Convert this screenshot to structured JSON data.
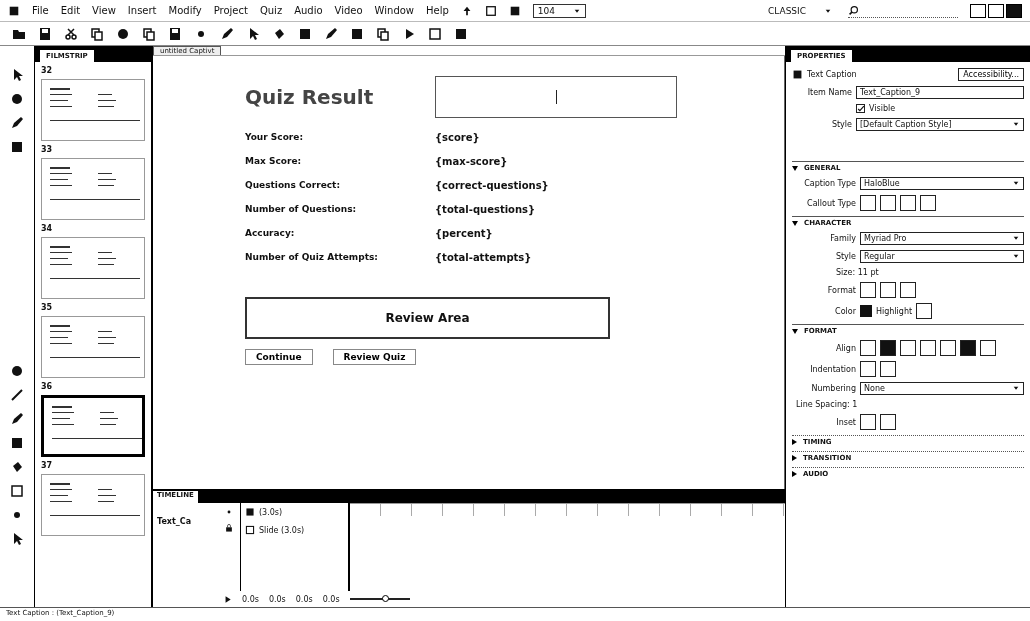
{
  "menu": [
    "File",
    "Edit",
    "View",
    "Insert",
    "Modify",
    "Project",
    "Quiz",
    "Audio",
    "Video",
    "Window",
    "Help"
  ],
  "zoom": {
    "value": "104"
  },
  "workspace": {
    "label": "CLASSIC"
  },
  "filmstrip": {
    "title": "FILMSTRIP",
    "slides": [
      {
        "number": "32",
        "selected": false
      },
      {
        "number": "33",
        "selected": false
      },
      {
        "number": "34",
        "selected": false
      },
      {
        "number": "35",
        "selected": false
      },
      {
        "number": "36",
        "selected": true
      },
      {
        "number": "37",
        "selected": false
      }
    ]
  },
  "document_tab": {
    "title": "untitled Captivt"
  },
  "slide": {
    "title": "Quiz Result",
    "rows": [
      {
        "label": "Your Score:",
        "value": "{score}"
      },
      {
        "label": "Max Score:",
        "value": "{max-score}"
      },
      {
        "label": "Questions Correct:",
        "value": "{correct-questions}"
      },
      {
        "label": "Number of Questions:",
        "value": "{total-questions}"
      },
      {
        "label": "Accuracy:",
        "value": "{percent}"
      },
      {
        "label": "Number of Quiz Attempts:",
        "value": "{total-attempts}"
      }
    ],
    "review_area": "Review Area",
    "buttons": [
      "Continue",
      "Review Quiz"
    ]
  },
  "timeline": {
    "title": "TIMELINE",
    "layer": "Text_Ca",
    "items": [
      "(3.0s)",
      "Slide (3.0s)"
    ],
    "times": [
      "0.0s",
      "0.0s",
      "0.0s",
      "0.0s"
    ],
    "zoom_slider": {
      "level": 0.6
    }
  },
  "properties": {
    "title": "PROPERTIES",
    "object": "Text Caption",
    "accessibility": "Accessibility...",
    "item_name_label": "Item Name",
    "item_name": "Text_Caption_9",
    "visible": {
      "label": "Visible",
      "checked": true
    },
    "style_label": "Style",
    "style": "[Default Caption Style]",
    "sections": [
      {
        "title": "GENERAL",
        "expanded": true,
        "kind": "general"
      },
      {
        "title": "CHARACTER",
        "expanded": true,
        "kind": "character"
      },
      {
        "title": "FORMAT",
        "expanded": true,
        "kind": "format"
      },
      {
        "title": "TIMING",
        "expanded": false,
        "kind": "none"
      },
      {
        "title": "TRANSITION",
        "expanded": false,
        "kind": "none"
      },
      {
        "title": "AUDIO",
        "expanded": false,
        "kind": "none"
      }
    ],
    "general": {
      "caption_type_label": "Caption Type",
      "caption_type": "HaloBlue",
      "callout_type_label": "Callout Type"
    },
    "character": {
      "family_label": "Family",
      "family": "Myriad Pro",
      "style_label": "Style",
      "style": "Regular",
      "size": "Size: 11 pt",
      "format_label": "Format",
      "color_label": "Color",
      "highlight_label": "Highlight"
    },
    "format": {
      "align_label": "Align",
      "align_options": [
        {
          "selected": false
        },
        {
          "selected": true
        },
        {
          "selected": false
        },
        {
          "selected": false
        },
        {
          "selected": false
        },
        {
          "selected": true
        },
        {
          "selected": false
        }
      ],
      "indentation_label": "Indentation",
      "numbering_label": "Numbering",
      "numbering": "None",
      "line_spacing": "Line Spacing: 1",
      "inset_label": "Inset"
    }
  },
  "status_bar": {
    "text": "Text Caption : (Text_Caption_9)"
  }
}
